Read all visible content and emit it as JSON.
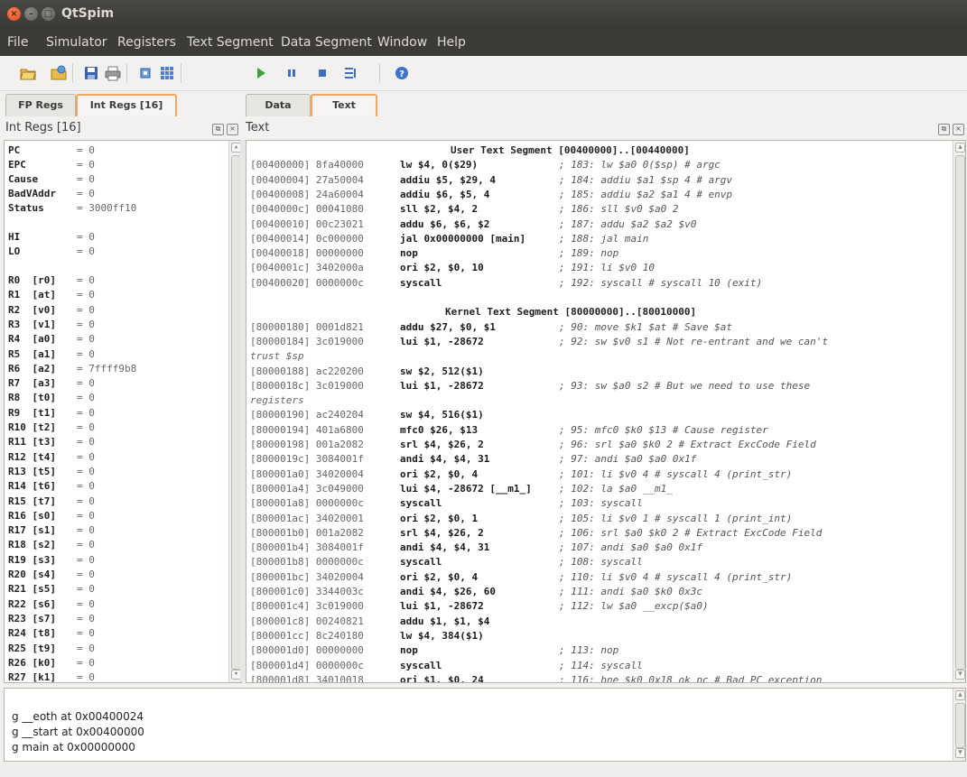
{
  "window": {
    "title": "QtSpim"
  },
  "menu": [
    "File",
    "Simulator",
    "Registers",
    "Text Segment",
    "Data Segment",
    "Window",
    "Help"
  ],
  "toolbar": [
    "open-folder-icon",
    "reload-icon",
    "save-icon",
    "print-icon",
    "clear-registers-icon",
    "memory-grid-icon",
    "run-icon",
    "pause-icon",
    "stop-icon",
    "single-step-icon",
    "help-icon"
  ],
  "left_tabs": [
    {
      "label": "FP Regs",
      "active": false
    },
    {
      "label": "Int Regs [16]",
      "active": true
    }
  ],
  "right_tabs": [
    {
      "label": "Data",
      "active": false
    },
    {
      "label": "Text",
      "active": true
    }
  ],
  "regs_panel": {
    "title": "Int Regs [16]",
    "special": [
      {
        "name": "PC",
        "value": "= 0"
      },
      {
        "name": "EPC",
        "value": "= 0"
      },
      {
        "name": "Cause",
        "value": "= 0"
      },
      {
        "name": "BadVAddr",
        "value": "= 0"
      },
      {
        "name": "Status",
        "value": "= 3000ff10"
      },
      {
        "name": "HI",
        "value": "= 0"
      },
      {
        "name": "LO",
        "value": "= 0"
      }
    ],
    "general": [
      {
        "name": "R0  [r0]",
        "value": "= 0"
      },
      {
        "name": "R1  [at]",
        "value": "= 0"
      },
      {
        "name": "R2  [v0]",
        "value": "= 0"
      },
      {
        "name": "R3  [v1]",
        "value": "= 0"
      },
      {
        "name": "R4  [a0]",
        "value": "= 0"
      },
      {
        "name": "R5  [a1]",
        "value": "= 0"
      },
      {
        "name": "R6  [a2]",
        "value": "= 7ffff9b8"
      },
      {
        "name": "R7  [a3]",
        "value": "= 0"
      },
      {
        "name": "R8  [t0]",
        "value": "= 0"
      },
      {
        "name": "R9  [t1]",
        "value": "= 0"
      },
      {
        "name": "R10 [t2]",
        "value": "= 0"
      },
      {
        "name": "R11 [t3]",
        "value": "= 0"
      },
      {
        "name": "R12 [t4]",
        "value": "= 0"
      },
      {
        "name": "R13 [t5]",
        "value": "= 0"
      },
      {
        "name": "R14 [t6]",
        "value": "= 0"
      },
      {
        "name": "R15 [t7]",
        "value": "= 0"
      },
      {
        "name": "R16 [s0]",
        "value": "= 0"
      },
      {
        "name": "R17 [s1]",
        "value": "= 0"
      },
      {
        "name": "R18 [s2]",
        "value": "= 0"
      },
      {
        "name": "R19 [s3]",
        "value": "= 0"
      },
      {
        "name": "R20 [s4]",
        "value": "= 0"
      },
      {
        "name": "R21 [s5]",
        "value": "= 0"
      },
      {
        "name": "R22 [s6]",
        "value": "= 0"
      },
      {
        "name": "R23 [s7]",
        "value": "= 0"
      },
      {
        "name": "R24 [t8]",
        "value": "= 0"
      },
      {
        "name": "R25 [t9]",
        "value": "= 0"
      },
      {
        "name": "R26 [k0]",
        "value": "= 0"
      },
      {
        "name": "R27 [k1]",
        "value": "= 0"
      }
    ]
  },
  "text_panel": {
    "title": "Text",
    "user_header": "User Text Segment [00400000]..[00440000]",
    "user_lines": [
      {
        "addr": "[00400000] 8fa40000",
        "ins": "lw $4, 0($29)",
        "cm": "; 183: lw $a0 0($sp) # argc"
      },
      {
        "addr": "[00400004] 27a50004",
        "ins": "addiu $5, $29, 4",
        "cm": "; 184: addiu $a1 $sp 4 # argv"
      },
      {
        "addr": "[00400008] 24a60004",
        "ins": "addiu $6, $5, 4",
        "cm": "; 185: addiu $a2 $a1 4 # envp"
      },
      {
        "addr": "[0040000c] 00041080",
        "ins": "sll $2, $4, 2",
        "cm": "; 186: sll $v0 $a0 2"
      },
      {
        "addr": "[00400010] 00c23021",
        "ins": "addu $6, $6, $2",
        "cm": "; 187: addu $a2 $a2 $v0"
      },
      {
        "addr": "[00400014] 0c000000",
        "ins": "jal 0x00000000 [main]",
        "cm": "; 188: jal main"
      },
      {
        "addr": "[00400018] 00000000",
        "ins": "nop",
        "cm": "; 189: nop"
      },
      {
        "addr": "[0040001c] 3402000a",
        "ins": "ori $2, $0, 10",
        "cm": "; 191: li $v0 10"
      },
      {
        "addr": "[00400020] 0000000c",
        "ins": "syscall",
        "cm": "; 192: syscall # syscall 10 (exit)"
      }
    ],
    "kernel_header": "Kernel Text Segment [80000000]..[80010000]",
    "kernel_lines": [
      {
        "addr": "[80000180] 0001d821",
        "ins": "addu $27, $0, $1",
        "cm": "; 90: move $k1 $at # Save $at"
      },
      {
        "addr": "[80000184] 3c019000",
        "ins": "lui $1, -28672",
        "cm": "; 92: sw $v0 s1 # Not re-entrant and we can't"
      },
      {
        "cont": "trust $sp"
      },
      {
        "addr": "[80000188] ac220200",
        "ins": "sw $2, 512($1)",
        "cm": ""
      },
      {
        "addr": "[8000018c] 3c019000",
        "ins": "lui $1, -28672",
        "cm": "; 93: sw $a0 s2 # But we need to use these"
      },
      {
        "cont": "registers"
      },
      {
        "addr": "[80000190] ac240204",
        "ins": "sw $4, 516($1)",
        "cm": ""
      },
      {
        "addr": "[80000194] 401a6800",
        "ins": "mfc0 $26, $13",
        "cm": "; 95: mfc0 $k0 $13 # Cause register"
      },
      {
        "addr": "[80000198] 001a2082",
        "ins": "srl $4, $26, 2",
        "cm": "; 96: srl $a0 $k0 2 # Extract ExcCode Field"
      },
      {
        "addr": "[8000019c] 3084001f",
        "ins": "andi $4, $4, 31",
        "cm": "; 97: andi $a0 $a0 0x1f"
      },
      {
        "addr": "[800001a0] 34020004",
        "ins": "ori $2, $0, 4",
        "cm": "; 101: li $v0 4 # syscall 4 (print_str)"
      },
      {
        "addr": "[800001a4] 3c049000",
        "ins": "lui $4, -28672 [__m1_]",
        "cm": "; 102: la $a0 __m1_"
      },
      {
        "addr": "[800001a8] 0000000c",
        "ins": "syscall",
        "cm": "; 103: syscall"
      },
      {
        "addr": "[800001ac] 34020001",
        "ins": "ori $2, $0, 1",
        "cm": "; 105: li $v0 1 # syscall 1 (print_int)"
      },
      {
        "addr": "[800001b0] 001a2082",
        "ins": "srl $4, $26, 2",
        "cm": "; 106: srl $a0 $k0 2 # Extract ExcCode Field"
      },
      {
        "addr": "[800001b4] 3084001f",
        "ins": "andi $4, $4, 31",
        "cm": "; 107: andi $a0 $a0 0x1f"
      },
      {
        "addr": "[800001b8] 0000000c",
        "ins": "syscall",
        "cm": "; 108: syscall"
      },
      {
        "addr": "[800001bc] 34020004",
        "ins": "ori $2, $0, 4",
        "cm": "; 110: li $v0 4 # syscall 4 (print_str)"
      },
      {
        "addr": "[800001c0] 3344003c",
        "ins": "andi $4, $26, 60",
        "cm": "; 111: andi $a0 $k0 0x3c"
      },
      {
        "addr": "[800001c4] 3c019000",
        "ins": "lui $1, -28672",
        "cm": "; 112: lw $a0 __excp($a0)"
      },
      {
        "addr": "[800001c8] 00240821",
        "ins": "addu $1, $1, $4",
        "cm": ""
      },
      {
        "addr": "[800001cc] 8c240180",
        "ins": "lw $4, 384($1)",
        "cm": ""
      },
      {
        "addr": "[800001d0] 00000000",
        "ins": "nop",
        "cm": "; 113: nop"
      },
      {
        "addr": "[800001d4] 0000000c",
        "ins": "syscall",
        "cm": "; 114: syscall"
      },
      {
        "addr": "[800001d8] 34010018",
        "ins": "ori $1, $0, 24",
        "cm": "; 116: bne $k0 0x18 ok_pc # Bad PC exception"
      }
    ]
  },
  "messages": [
    "g __eoth at 0x00400024",
    "g __start at 0x00400000",
    "g main at 0x00000000"
  ]
}
